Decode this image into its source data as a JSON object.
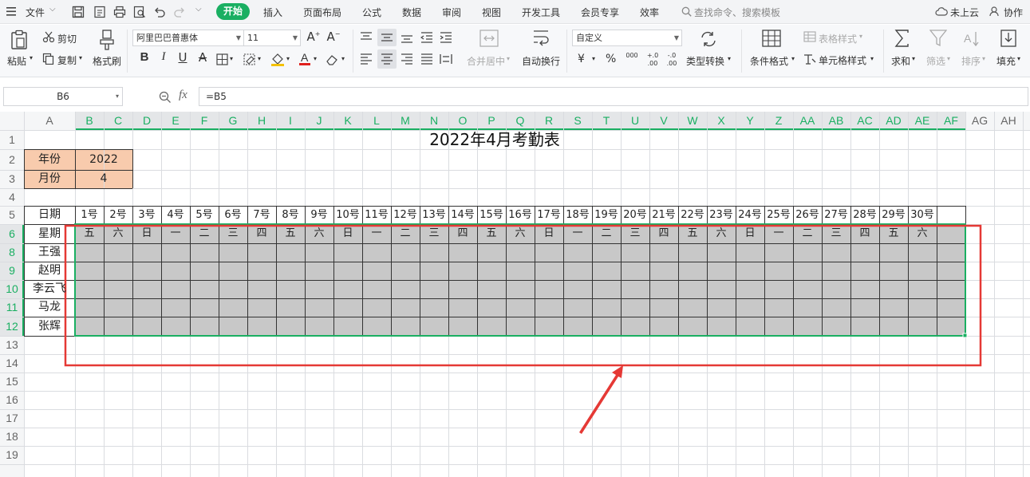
{
  "menubar": {
    "file_label": "文件",
    "tabs": [
      "开始",
      "插入",
      "页面布局",
      "公式",
      "数据",
      "审阅",
      "视图",
      "开发工具",
      "会员专享",
      "效率"
    ],
    "active_tab": "开始",
    "search_placeholder": "查找命令、搜索模板",
    "cloud_status": "未上云",
    "collab_label": "协作"
  },
  "ribbon": {
    "paste": "粘贴",
    "cut": "剪切",
    "copy": "复制",
    "format_painter": "格式刷",
    "font_name": "阿里巴巴普惠体",
    "font_size": "11",
    "merge_center": "合并居中",
    "wrap_text": "自动换行",
    "number_format": "自定义",
    "type_convert": "类型转换",
    "conditional_format": "条件格式",
    "table_style": "表格样式",
    "cell_style": "单元格样式",
    "sum": "求和",
    "filter": "筛选",
    "sort": "排序",
    "fill": "填充",
    "currency_symbol": "¥",
    "percent_symbol": "%",
    "thousands_symbol": "000",
    "inc_decimal": "+.0 .00",
    "dec_decimal": "-.0 .00"
  },
  "formula_bar": {
    "name_box": "B6",
    "fx_label": "fx",
    "formula": "=B5"
  },
  "sheet": {
    "col_headers": [
      "A",
      "B",
      "C",
      "D",
      "E",
      "F",
      "G",
      "H",
      "I",
      "J",
      "K",
      "L",
      "M",
      "N",
      "O",
      "P",
      "Q",
      "R",
      "S",
      "T",
      "U",
      "V",
      "W",
      "X",
      "Y",
      "Z",
      "AA",
      "AB",
      "AC",
      "AD",
      "AE",
      "AF",
      "AG",
      "AH"
    ],
    "row_headers": [
      "1",
      "2",
      "3",
      "4",
      "5",
      "6",
      "8",
      "9",
      "10",
      "11",
      "12",
      "13",
      "14",
      "15",
      "16",
      "17",
      "18",
      "19"
    ],
    "title": "2022年4月考勤表",
    "year_label": "年份",
    "year_value": "2022",
    "month_label": "月份",
    "month_value": "4",
    "date_label": "日期",
    "weekday_label": "星期",
    "dates": [
      "1号",
      "2号",
      "3号",
      "4号",
      "5号",
      "6号",
      "7号",
      "8号",
      "9号",
      "10号",
      "11号",
      "12号",
      "13号",
      "14号",
      "15号",
      "16号",
      "17号",
      "18号",
      "19号",
      "20号",
      "21号",
      "22号",
      "23号",
      "24号",
      "25号",
      "26号",
      "27号",
      "28号",
      "29号",
      "30号"
    ],
    "weekdays": [
      "五",
      "六",
      "日",
      "一",
      "二",
      "三",
      "四",
      "五",
      "六",
      "日",
      "一",
      "二",
      "三",
      "四",
      "五",
      "六",
      "日",
      "一",
      "二",
      "三",
      "四",
      "五",
      "六",
      "日",
      "一",
      "二",
      "三",
      "四",
      "五",
      "六"
    ],
    "employees": [
      "王强",
      "赵明",
      "李云飞",
      "马龙",
      "张辉"
    ]
  },
  "colors": {
    "accent_green": "#1aaf62",
    "header_peach": "#f8cbad",
    "selected_gray": "#c8c8c8",
    "annotation_red": "#e53935"
  }
}
